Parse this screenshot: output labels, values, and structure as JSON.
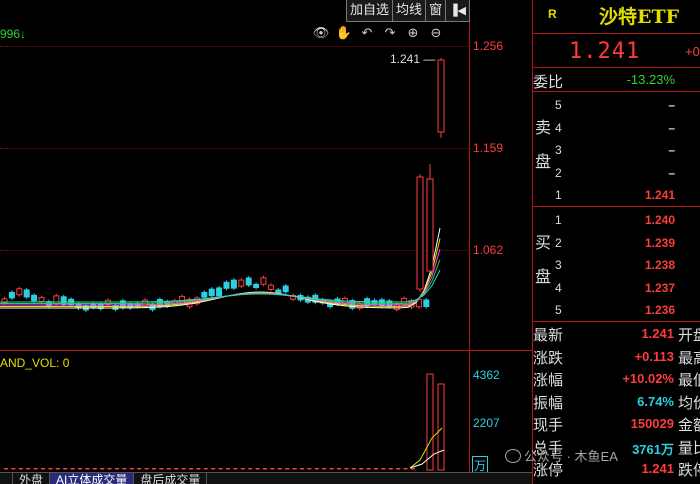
{
  "toolbar": {
    "add_watch": "加自选",
    "ma": "均线",
    "window": "窗",
    "arrow": "◀"
  },
  "chart": {
    "ma_value": "996↓",
    "current_price_label": "1.241",
    "price_ticks": [
      "1.256",
      "1.159",
      "1.062"
    ],
    "volume_label": "AND_VOL: 0",
    "volume_ticks": [
      "4362",
      "2207"
    ],
    "volume_unit": "万",
    "icons": [
      "eye-icon",
      "hand-icon",
      "undo-icon",
      "redo-icon",
      "zoom-in-icon",
      "zoom-out-icon"
    ]
  },
  "tabs": [
    "",
    "外盘",
    "AI立体成交量",
    "盘后成交量"
  ],
  "active_tab": 2,
  "header": {
    "badge": "R",
    "name": "沙特ETF"
  },
  "quote": {
    "price": "1.241",
    "change": "+0",
    "webi_label": "委比",
    "webi_value": "-13.23%"
  },
  "sell_side_label": [
    "卖",
    "盘"
  ],
  "buy_side_label": [
    "买",
    "盘"
  ],
  "sell_book": [
    {
      "level": "5",
      "price": "–"
    },
    {
      "level": "4",
      "price": "–"
    },
    {
      "level": "3",
      "price": "–"
    },
    {
      "level": "2",
      "price": "–"
    },
    {
      "level": "1",
      "price": "1.241"
    }
  ],
  "buy_book": [
    {
      "level": "1",
      "price": "1.240"
    },
    {
      "level": "2",
      "price": "1.239"
    },
    {
      "level": "3",
      "price": "1.238"
    },
    {
      "level": "4",
      "price": "1.237"
    },
    {
      "level": "5",
      "price": "1.236"
    }
  ],
  "stats": [
    {
      "label": "最新",
      "value": "1.241",
      "right": "开盘",
      "color": "red"
    },
    {
      "label": "涨跌",
      "value": "+0.113",
      "right": "最高",
      "color": "red"
    },
    {
      "label": "涨幅",
      "value": "+10.02%",
      "right": "最低",
      "color": "red"
    },
    {
      "label": "振幅",
      "value": "6.74%",
      "right": "均价",
      "color": "cyan"
    },
    {
      "label": "现手",
      "value": "150029",
      "right": "金额",
      "color": "red"
    },
    {
      "label": "总手",
      "value": "3761万",
      "right": "量比",
      "color": "cyan"
    },
    {
      "label": "涨停",
      "value": "1.241",
      "right": "跌停",
      "color": "red"
    }
  ],
  "watermark": "公众号 · 木鱼EA"
}
